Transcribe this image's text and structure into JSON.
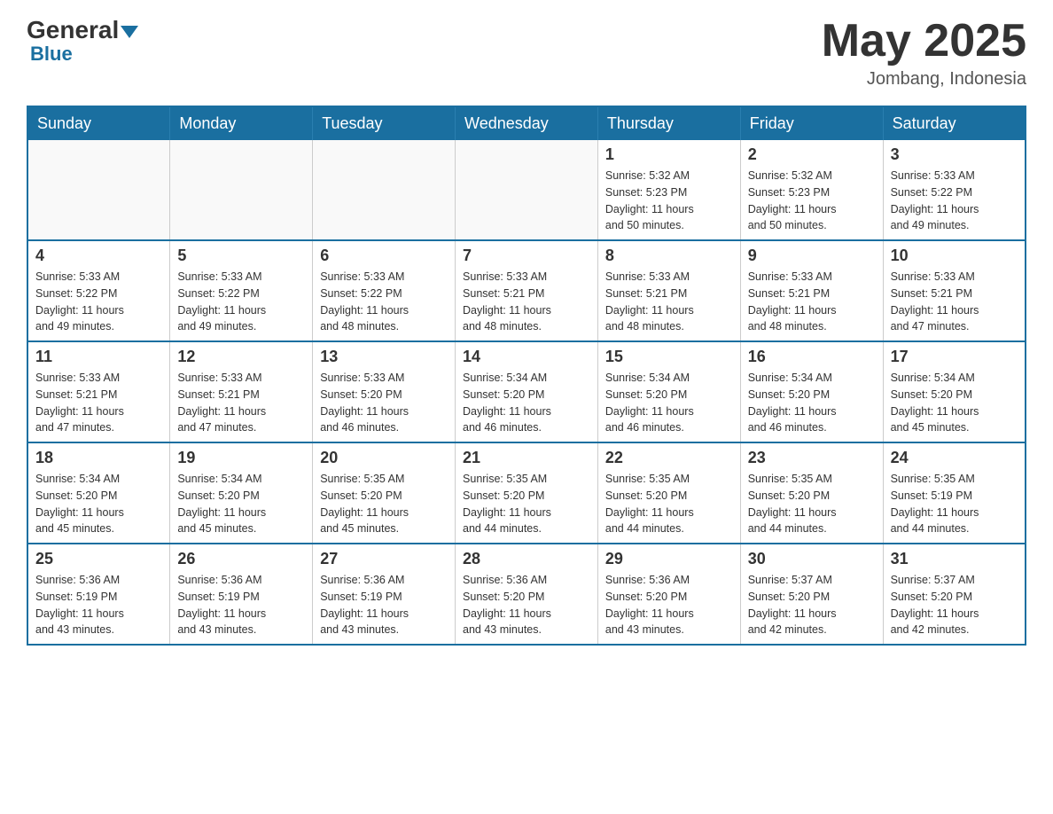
{
  "logo": {
    "general": "General",
    "blue": "Blue"
  },
  "header": {
    "month_year": "May 2025",
    "location": "Jombang, Indonesia"
  },
  "days_of_week": [
    "Sunday",
    "Monday",
    "Tuesday",
    "Wednesday",
    "Thursday",
    "Friday",
    "Saturday"
  ],
  "weeks": [
    [
      {
        "day": "",
        "info": ""
      },
      {
        "day": "",
        "info": ""
      },
      {
        "day": "",
        "info": ""
      },
      {
        "day": "",
        "info": ""
      },
      {
        "day": "1",
        "info": "Sunrise: 5:32 AM\nSunset: 5:23 PM\nDaylight: 11 hours\nand 50 minutes."
      },
      {
        "day": "2",
        "info": "Sunrise: 5:32 AM\nSunset: 5:23 PM\nDaylight: 11 hours\nand 50 minutes."
      },
      {
        "day": "3",
        "info": "Sunrise: 5:33 AM\nSunset: 5:22 PM\nDaylight: 11 hours\nand 49 minutes."
      }
    ],
    [
      {
        "day": "4",
        "info": "Sunrise: 5:33 AM\nSunset: 5:22 PM\nDaylight: 11 hours\nand 49 minutes."
      },
      {
        "day": "5",
        "info": "Sunrise: 5:33 AM\nSunset: 5:22 PM\nDaylight: 11 hours\nand 49 minutes."
      },
      {
        "day": "6",
        "info": "Sunrise: 5:33 AM\nSunset: 5:22 PM\nDaylight: 11 hours\nand 48 minutes."
      },
      {
        "day": "7",
        "info": "Sunrise: 5:33 AM\nSunset: 5:21 PM\nDaylight: 11 hours\nand 48 minutes."
      },
      {
        "day": "8",
        "info": "Sunrise: 5:33 AM\nSunset: 5:21 PM\nDaylight: 11 hours\nand 48 minutes."
      },
      {
        "day": "9",
        "info": "Sunrise: 5:33 AM\nSunset: 5:21 PM\nDaylight: 11 hours\nand 48 minutes."
      },
      {
        "day": "10",
        "info": "Sunrise: 5:33 AM\nSunset: 5:21 PM\nDaylight: 11 hours\nand 47 minutes."
      }
    ],
    [
      {
        "day": "11",
        "info": "Sunrise: 5:33 AM\nSunset: 5:21 PM\nDaylight: 11 hours\nand 47 minutes."
      },
      {
        "day": "12",
        "info": "Sunrise: 5:33 AM\nSunset: 5:21 PM\nDaylight: 11 hours\nand 47 minutes."
      },
      {
        "day": "13",
        "info": "Sunrise: 5:33 AM\nSunset: 5:20 PM\nDaylight: 11 hours\nand 46 minutes."
      },
      {
        "day": "14",
        "info": "Sunrise: 5:34 AM\nSunset: 5:20 PM\nDaylight: 11 hours\nand 46 minutes."
      },
      {
        "day": "15",
        "info": "Sunrise: 5:34 AM\nSunset: 5:20 PM\nDaylight: 11 hours\nand 46 minutes."
      },
      {
        "day": "16",
        "info": "Sunrise: 5:34 AM\nSunset: 5:20 PM\nDaylight: 11 hours\nand 46 minutes."
      },
      {
        "day": "17",
        "info": "Sunrise: 5:34 AM\nSunset: 5:20 PM\nDaylight: 11 hours\nand 45 minutes."
      }
    ],
    [
      {
        "day": "18",
        "info": "Sunrise: 5:34 AM\nSunset: 5:20 PM\nDaylight: 11 hours\nand 45 minutes."
      },
      {
        "day": "19",
        "info": "Sunrise: 5:34 AM\nSunset: 5:20 PM\nDaylight: 11 hours\nand 45 minutes."
      },
      {
        "day": "20",
        "info": "Sunrise: 5:35 AM\nSunset: 5:20 PM\nDaylight: 11 hours\nand 45 minutes."
      },
      {
        "day": "21",
        "info": "Sunrise: 5:35 AM\nSunset: 5:20 PM\nDaylight: 11 hours\nand 44 minutes."
      },
      {
        "day": "22",
        "info": "Sunrise: 5:35 AM\nSunset: 5:20 PM\nDaylight: 11 hours\nand 44 minutes."
      },
      {
        "day": "23",
        "info": "Sunrise: 5:35 AM\nSunset: 5:20 PM\nDaylight: 11 hours\nand 44 minutes."
      },
      {
        "day": "24",
        "info": "Sunrise: 5:35 AM\nSunset: 5:19 PM\nDaylight: 11 hours\nand 44 minutes."
      }
    ],
    [
      {
        "day": "25",
        "info": "Sunrise: 5:36 AM\nSunset: 5:19 PM\nDaylight: 11 hours\nand 43 minutes."
      },
      {
        "day": "26",
        "info": "Sunrise: 5:36 AM\nSunset: 5:19 PM\nDaylight: 11 hours\nand 43 minutes."
      },
      {
        "day": "27",
        "info": "Sunrise: 5:36 AM\nSunset: 5:19 PM\nDaylight: 11 hours\nand 43 minutes."
      },
      {
        "day": "28",
        "info": "Sunrise: 5:36 AM\nSunset: 5:20 PM\nDaylight: 11 hours\nand 43 minutes."
      },
      {
        "day": "29",
        "info": "Sunrise: 5:36 AM\nSunset: 5:20 PM\nDaylight: 11 hours\nand 43 minutes."
      },
      {
        "day": "30",
        "info": "Sunrise: 5:37 AM\nSunset: 5:20 PM\nDaylight: 11 hours\nand 42 minutes."
      },
      {
        "day": "31",
        "info": "Sunrise: 5:37 AM\nSunset: 5:20 PM\nDaylight: 11 hours\nand 42 minutes."
      }
    ]
  ]
}
